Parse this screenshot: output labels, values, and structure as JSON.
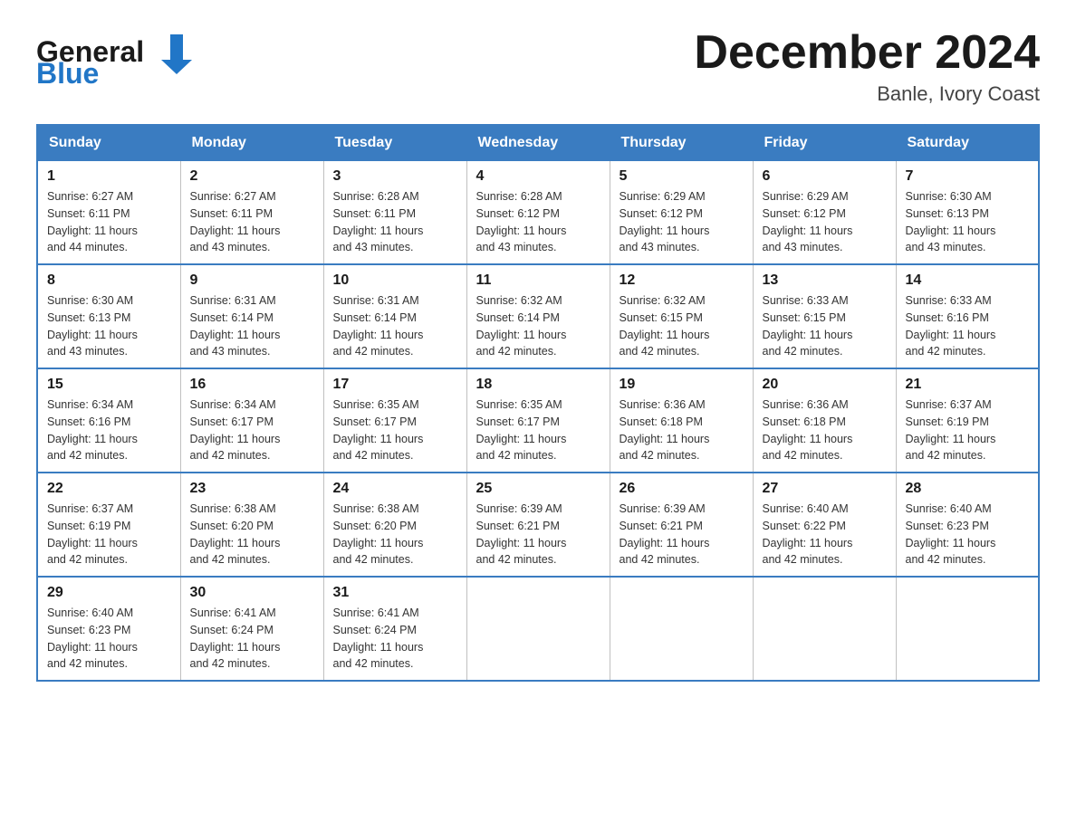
{
  "header": {
    "logo_text_general": "General",
    "logo_text_blue": "Blue",
    "month_title": "December 2024",
    "location": "Banle, Ivory Coast"
  },
  "days_of_week": [
    "Sunday",
    "Monday",
    "Tuesday",
    "Wednesday",
    "Thursday",
    "Friday",
    "Saturday"
  ],
  "weeks": [
    [
      {
        "day": "1",
        "sunrise": "6:27 AM",
        "sunset": "6:11 PM",
        "daylight": "11 hours and 44 minutes."
      },
      {
        "day": "2",
        "sunrise": "6:27 AM",
        "sunset": "6:11 PM",
        "daylight": "11 hours and 43 minutes."
      },
      {
        "day": "3",
        "sunrise": "6:28 AM",
        "sunset": "6:11 PM",
        "daylight": "11 hours and 43 minutes."
      },
      {
        "day": "4",
        "sunrise": "6:28 AM",
        "sunset": "6:12 PM",
        "daylight": "11 hours and 43 minutes."
      },
      {
        "day": "5",
        "sunrise": "6:29 AM",
        "sunset": "6:12 PM",
        "daylight": "11 hours and 43 minutes."
      },
      {
        "day": "6",
        "sunrise": "6:29 AM",
        "sunset": "6:12 PM",
        "daylight": "11 hours and 43 minutes."
      },
      {
        "day": "7",
        "sunrise": "6:30 AM",
        "sunset": "6:13 PM",
        "daylight": "11 hours and 43 minutes."
      }
    ],
    [
      {
        "day": "8",
        "sunrise": "6:30 AM",
        "sunset": "6:13 PM",
        "daylight": "11 hours and 43 minutes."
      },
      {
        "day": "9",
        "sunrise": "6:31 AM",
        "sunset": "6:14 PM",
        "daylight": "11 hours and 43 minutes."
      },
      {
        "day": "10",
        "sunrise": "6:31 AM",
        "sunset": "6:14 PM",
        "daylight": "11 hours and 42 minutes."
      },
      {
        "day": "11",
        "sunrise": "6:32 AM",
        "sunset": "6:14 PM",
        "daylight": "11 hours and 42 minutes."
      },
      {
        "day": "12",
        "sunrise": "6:32 AM",
        "sunset": "6:15 PM",
        "daylight": "11 hours and 42 minutes."
      },
      {
        "day": "13",
        "sunrise": "6:33 AM",
        "sunset": "6:15 PM",
        "daylight": "11 hours and 42 minutes."
      },
      {
        "day": "14",
        "sunrise": "6:33 AM",
        "sunset": "6:16 PM",
        "daylight": "11 hours and 42 minutes."
      }
    ],
    [
      {
        "day": "15",
        "sunrise": "6:34 AM",
        "sunset": "6:16 PM",
        "daylight": "11 hours and 42 minutes."
      },
      {
        "day": "16",
        "sunrise": "6:34 AM",
        "sunset": "6:17 PM",
        "daylight": "11 hours and 42 minutes."
      },
      {
        "day": "17",
        "sunrise": "6:35 AM",
        "sunset": "6:17 PM",
        "daylight": "11 hours and 42 minutes."
      },
      {
        "day": "18",
        "sunrise": "6:35 AM",
        "sunset": "6:17 PM",
        "daylight": "11 hours and 42 minutes."
      },
      {
        "day": "19",
        "sunrise": "6:36 AM",
        "sunset": "6:18 PM",
        "daylight": "11 hours and 42 minutes."
      },
      {
        "day": "20",
        "sunrise": "6:36 AM",
        "sunset": "6:18 PM",
        "daylight": "11 hours and 42 minutes."
      },
      {
        "day": "21",
        "sunrise": "6:37 AM",
        "sunset": "6:19 PM",
        "daylight": "11 hours and 42 minutes."
      }
    ],
    [
      {
        "day": "22",
        "sunrise": "6:37 AM",
        "sunset": "6:19 PM",
        "daylight": "11 hours and 42 minutes."
      },
      {
        "day": "23",
        "sunrise": "6:38 AM",
        "sunset": "6:20 PM",
        "daylight": "11 hours and 42 minutes."
      },
      {
        "day": "24",
        "sunrise": "6:38 AM",
        "sunset": "6:20 PM",
        "daylight": "11 hours and 42 minutes."
      },
      {
        "day": "25",
        "sunrise": "6:39 AM",
        "sunset": "6:21 PM",
        "daylight": "11 hours and 42 minutes."
      },
      {
        "day": "26",
        "sunrise": "6:39 AM",
        "sunset": "6:21 PM",
        "daylight": "11 hours and 42 minutes."
      },
      {
        "day": "27",
        "sunrise": "6:40 AM",
        "sunset": "6:22 PM",
        "daylight": "11 hours and 42 minutes."
      },
      {
        "day": "28",
        "sunrise": "6:40 AM",
        "sunset": "6:23 PM",
        "daylight": "11 hours and 42 minutes."
      }
    ],
    [
      {
        "day": "29",
        "sunrise": "6:40 AM",
        "sunset": "6:23 PM",
        "daylight": "11 hours and 42 minutes."
      },
      {
        "day": "30",
        "sunrise": "6:41 AM",
        "sunset": "6:24 PM",
        "daylight": "11 hours and 42 minutes."
      },
      {
        "day": "31",
        "sunrise": "6:41 AM",
        "sunset": "6:24 PM",
        "daylight": "11 hours and 42 minutes."
      },
      null,
      null,
      null,
      null
    ]
  ],
  "labels": {
    "sunrise_prefix": "Sunrise: ",
    "sunset_prefix": "Sunset: ",
    "daylight_prefix": "Daylight: "
  }
}
